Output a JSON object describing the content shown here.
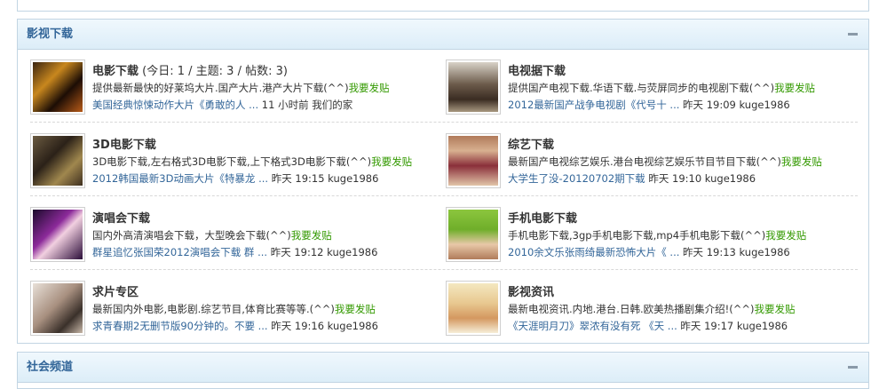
{
  "section": {
    "title": "影视下载"
  },
  "section2": {
    "title": "社会频道"
  },
  "icons": {
    "collapse": "minus-icon"
  },
  "colors": {
    "link_blue": "#336699",
    "post_green": "#339900",
    "border": "#c2d5e3"
  },
  "forums": [
    {
      "name": "电影下载",
      "stats": " (今日: 1 / 主题: 3 / 帖数: 3)",
      "desc": "提供最新最快的好莱坞大片.国产大片.港产大片下载(^^)",
      "post": "我要发贴",
      "last_thread": "美国经典惊悚动作大片《勇敢的人 ...",
      "last_meta": " 11 小时前 我们的家"
    },
    {
      "name": "电视据下载",
      "stats": "",
      "desc": "提供国产电视下载.华语下载.与荧屏同步的电视剧下载(^^)",
      "post": "我要发贴",
      "last_thread": "2012最新国产战争电视剧《代号十 ...",
      "last_meta": " 昨天 19:09 kuge1986"
    },
    {
      "name": "3D电影下载",
      "stats": "",
      "desc": "3D电影下载,左右格式3D电影下载,上下格式3D电影下载(^^)",
      "post": "我要发贴",
      "last_thread": "2012韩国最新3D动画大片《特暴龙 ...",
      "last_meta": " 昨天 19:15 kuge1986"
    },
    {
      "name": "综艺下载",
      "stats": "",
      "desc": "最新国产电视综艺娱乐.港台电视综艺娱乐节目节目下载(^^)",
      "post": "我要发贴",
      "last_thread": "大学生了没-20120702期下载",
      "last_meta": " 昨天 19:10 kuge1986"
    },
    {
      "name": "演唱会下载",
      "stats": "",
      "desc": "国内外高清演唱会下载，大型晚会下载(^^)",
      "post": "我要发贴",
      "last_thread": "群星追忆张国荣2012演唱会下载 群 ...",
      "last_meta": " 昨天 19:12 kuge1986"
    },
    {
      "name": "手机电影下载",
      "stats": "",
      "desc": "手机电影下载,3gp手机电影下载,mp4手机电影下载(^^)",
      "post": "我要发贴",
      "last_thread": "2010余文乐张雨绮最新恐怖大片《 ...",
      "last_meta": " 昨天 19:13 kuge1986"
    },
    {
      "name": "求片专区",
      "stats": "",
      "desc": "最新国内外电影,电影剧.综艺节目,体育比赛等等.(^^)",
      "post": "我要发贴",
      "last_thread": "求青春期2无删节版90分钟的。不要 ...",
      "last_meta": " 昨天 19:16 kuge1986"
    },
    {
      "name": "影视资讯",
      "stats": "",
      "desc": "最新电视资讯.内地.港台.日韩.欧美热播剧集介绍!(^^)",
      "post": "我要发贴",
      "last_thread": "《天涯明月刀》翠浓有没有死 《天 ...",
      "last_meta": " 昨天 19:17 kuge1986"
    }
  ]
}
